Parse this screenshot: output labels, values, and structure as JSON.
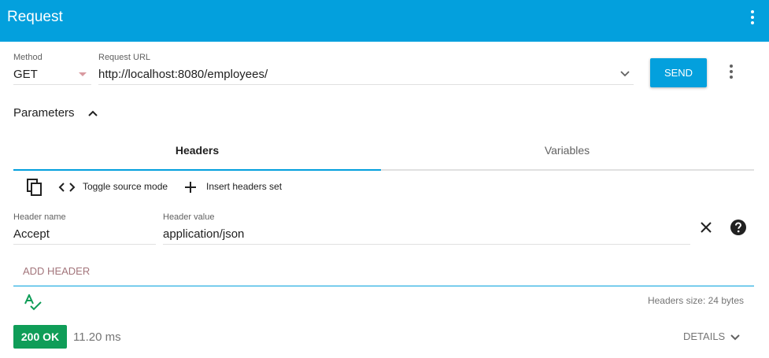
{
  "appbar": {
    "title": "Request",
    "menu_icon": "more-vert-icon"
  },
  "request": {
    "method_label": "Method",
    "method_value": "GET",
    "url_label": "Request URL",
    "url_value": "http://localhost:8080/employees/",
    "send_label": "SEND"
  },
  "parameters": {
    "label": "Parameters",
    "tabs": [
      {
        "label": "Headers"
      },
      {
        "label": "Variables"
      }
    ],
    "active_tab": "Headers"
  },
  "toolbar": {
    "copy_icon": "copy-icon",
    "toggle_source_label": "Toggle source mode",
    "insert_headers_label": "Insert headers set"
  },
  "headers": [
    {
      "name_label": "Header name",
      "name": "Accept",
      "value_label": "Header value",
      "value": "application/json"
    }
  ],
  "add_header_label": "ADD HEADER",
  "headers_size": "Headers size: 24 bytes",
  "response": {
    "status": "200 OK",
    "time": "11.20 ms",
    "details_label": "DETAILS"
  },
  "colors": {
    "accent": "#03a0dd",
    "status_ok": "#0f9d58",
    "validation_icon": "#0f9d58"
  }
}
